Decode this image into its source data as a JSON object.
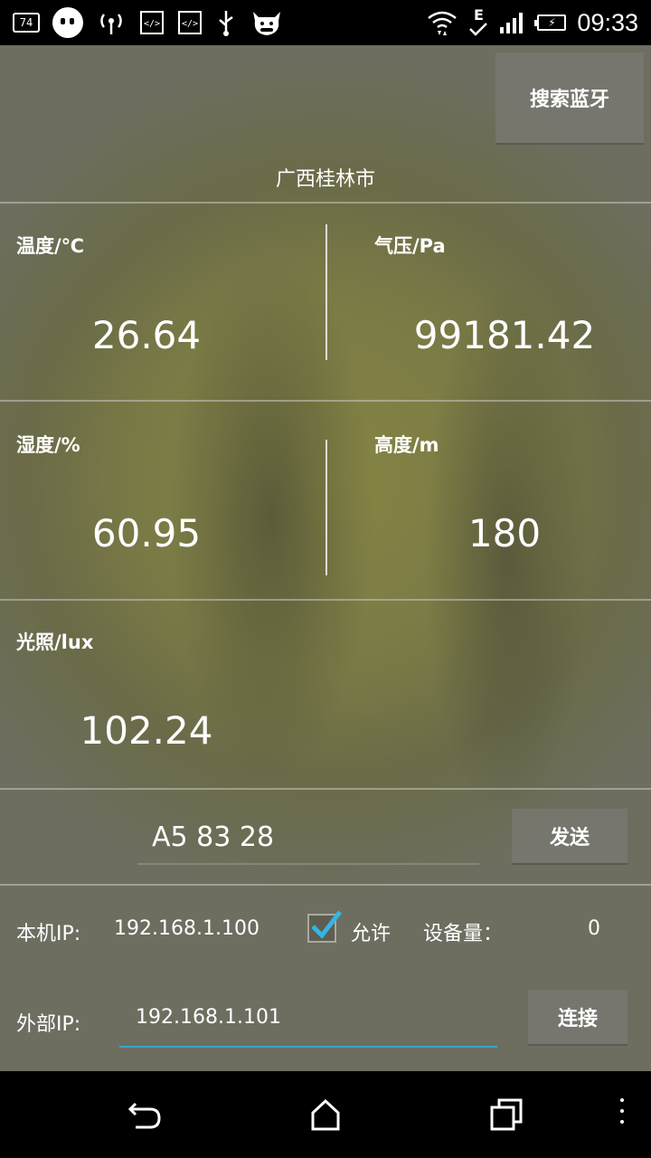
{
  "status_bar": {
    "notification_count": "74",
    "signal_letter": "E",
    "time": "09:33"
  },
  "header": {
    "search_bluetooth_label": "搜索蓝牙",
    "location": "广西桂林市"
  },
  "sensors": {
    "temperature": {
      "label": "温度/℃",
      "value": "26.64"
    },
    "pressure": {
      "label": "气压/Pa",
      "value": "99181.42"
    },
    "humidity": {
      "label": "湿度/%",
      "value": "60.95"
    },
    "altitude": {
      "label": "高度/m",
      "value": "180"
    },
    "light": {
      "label": "光照/lux",
      "value": "102.24"
    }
  },
  "send": {
    "input_value": "A5 83 28",
    "button_label": "发送"
  },
  "network": {
    "local_ip_label": "本机IP:",
    "local_ip_value": "192.168.1.100",
    "allow_label": "允许",
    "allow_checked": true,
    "device_count_label": "设备量：",
    "device_count_value": "0",
    "external_ip_label": "外部IP:",
    "external_ip_value": "192.168.1.101",
    "connect_label": "连接"
  },
  "colors": {
    "accent_check": "#33b5e5",
    "input_underline": "#3aa6c8"
  }
}
